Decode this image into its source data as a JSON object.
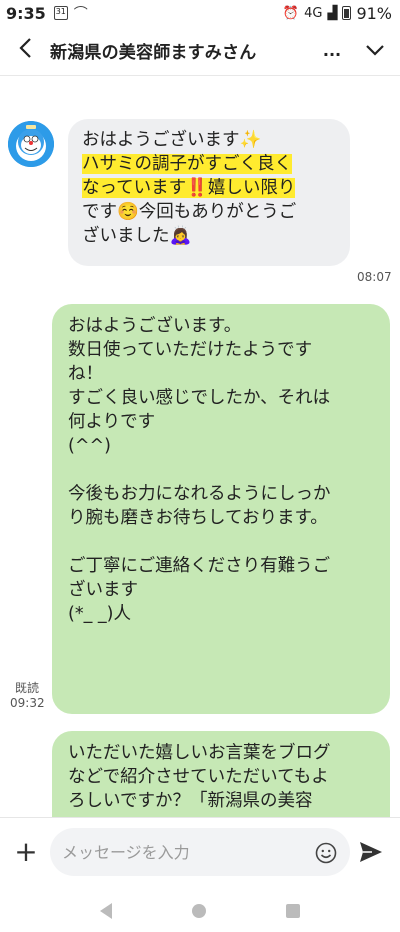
{
  "status": {
    "time": "9:35",
    "calendar": "31",
    "network": "4G",
    "battery": "91%"
  },
  "header": {
    "title": "新潟県の美容師ますみさん",
    "more": "..."
  },
  "messages": {
    "incoming": {
      "lines": [
        "おはようございます✨",
        "ハサミの調子がすごく良く",
        "なっています‼️嬉しい限り",
        "です☺️今回もありがとうご",
        "ざいました🙇‍♀️"
      ],
      "time": "08:07"
    },
    "outgoing1": {
      "lines": [
        "おはようございます。",
        "数日使っていただけたようです",
        "ね！",
        "すごく良い感じでしたか、それは",
        "何よりです",
        "(^^)",
        "",
        "今後もお力になれるようにしっか",
        "り腕も磨きお待ちしております。",
        "",
        "ご丁寧にご連絡くださり有難うご",
        "ざいます",
        "(*_ _)人"
      ],
      "read": "既読",
      "time": "09:32"
    },
    "outgoing2": {
      "lines": [
        "いただいた嬉しいお言葉をブログ",
        "などで紹介させていただいてもよ",
        "ろしいですか？「新潟県の美容"
      ]
    }
  },
  "input": {
    "placeholder": "メッセージを入力"
  },
  "icons": [
    "back-icon",
    "more-icon",
    "chevron-down-icon",
    "plus-icon",
    "emoji-icon",
    "send-icon",
    "nav-back-icon",
    "nav-home-icon",
    "nav-recent-icon"
  ]
}
